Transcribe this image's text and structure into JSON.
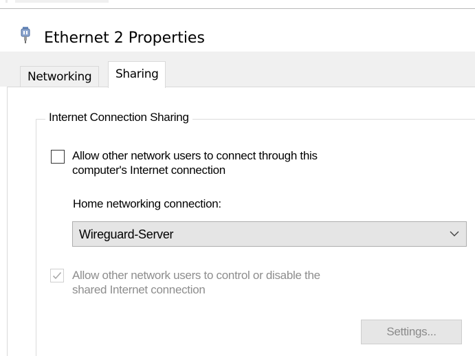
{
  "window": {
    "title": "Ethernet 2 Properties",
    "icon": "network-adapter-icon"
  },
  "tabs": [
    {
      "label": "Networking",
      "selected": false
    },
    {
      "label": "Sharing",
      "selected": true
    }
  ],
  "ics": {
    "group_title": "Internet Connection Sharing",
    "allow_connect": {
      "label_line1": "Allow other network users to connect through this",
      "label_line2": "computer's Internet connection",
      "checked": false
    },
    "home_connection": {
      "label": "Home networking connection:",
      "selected": "Wireguard-Server"
    },
    "allow_control": {
      "label_line1": "Allow other network users to control or disable the",
      "label_line2": "shared Internet connection",
      "checked": true,
      "disabled": true
    },
    "settings_button": "Settings..."
  }
}
